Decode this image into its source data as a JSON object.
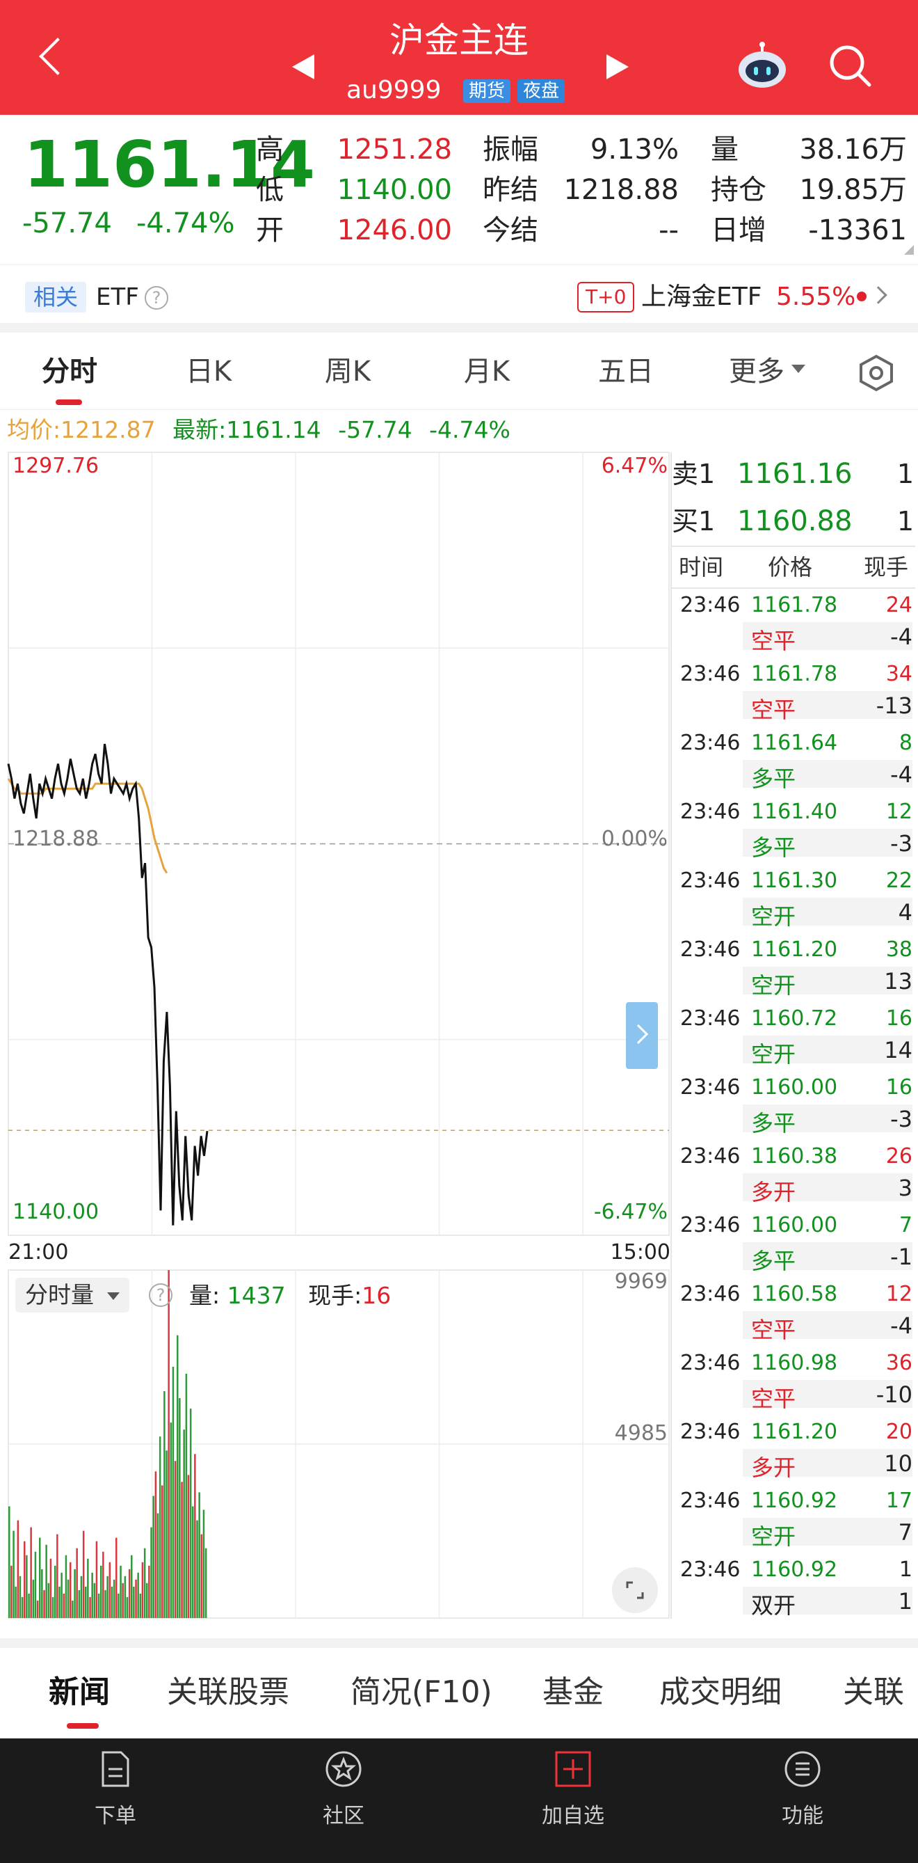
{
  "header": {
    "title": "沪金主连",
    "code": "au9999",
    "tags": [
      "期货",
      "夜盘"
    ]
  },
  "quote": {
    "last": "1161.14",
    "change": "-57.74",
    "change_pct": "-4.74%",
    "fields": [
      {
        "label": "高",
        "value": "1251.28",
        "color": "red"
      },
      {
        "label": "低",
        "value": "1140.00",
        "color": "green"
      },
      {
        "label": "开",
        "value": "1246.00",
        "color": "red"
      },
      {
        "label": "振幅",
        "value": "9.13%",
        "color": "dark"
      },
      {
        "label": "昨结",
        "value": "1218.88",
        "color": "dark"
      },
      {
        "label": "今结",
        "value": "--",
        "color": "dark"
      },
      {
        "label": "量",
        "value": "38.16万",
        "color": "dark"
      },
      {
        "label": "持仓",
        "value": "19.85万",
        "color": "dark"
      },
      {
        "label": "日增",
        "value": "-13361",
        "color": "dark"
      }
    ]
  },
  "etf": {
    "related_label": "相关",
    "etf_label": "ETF",
    "t0_label": "T+0",
    "fund_name": "上海金ETF",
    "fund_pct": "5.55%"
  },
  "tabs": [
    "分时",
    "日K",
    "周K",
    "月K",
    "五日",
    "更多"
  ],
  "active_tab": 0,
  "summary": {
    "avg_label": "均价:",
    "avg_value": "1212.87",
    "latest_label": "最新:",
    "latest_value": "1161.14",
    "change": "-57.74",
    "change_pct": "-4.74%"
  },
  "chart_data": {
    "type": "line",
    "y_top_label": "1297.76",
    "y_mid_label": "1218.88",
    "y_bottom_label": "1140.00",
    "pct_top": "6.47%",
    "pct_mid": "0.00%",
    "pct_bottom": "-6.47%",
    "x_start": "21:00",
    "x_end": "15:00",
    "ylim": [
      1140.0,
      1297.76
    ],
    "series": [
      {
        "values": [
          1235,
          1232,
          1228,
          1231,
          1227,
          1225,
          1229,
          1233,
          1228,
          1224,
          1231,
          1229,
          1232,
          1230,
          1228,
          1232,
          1235,
          1231,
          1229,
          1232,
          1236,
          1233,
          1230,
          1229,
          1232,
          1228,
          1231,
          1235,
          1237,
          1233,
          1231,
          1239,
          1235,
          1229,
          1232,
          1231,
          1230,
          1229,
          1231,
          1228,
          1230,
          1231,
          1224,
          1212,
          1215,
          1200,
          1198,
          1190,
          1170,
          1145,
          1175,
          1185,
          1170,
          1142,
          1165,
          1150,
          1143,
          1160,
          1148,
          1143,
          1158,
          1152,
          1160,
          1156,
          1161
        ]
      },
      {
        "values": [
          1232,
          1231,
          1230,
          1230,
          1229,
          1229,
          1229,
          1229,
          1229,
          1229,
          1229,
          1229,
          1230,
          1230,
          1230,
          1230,
          1230,
          1230,
          1230,
          1230,
          1230,
          1230,
          1230,
          1230,
          1230,
          1230,
          1230,
          1230,
          1231,
          1231,
          1231,
          1231,
          1231,
          1231,
          1231,
          1231,
          1231,
          1231,
          1231,
          1231,
          1231,
          1231,
          1231,
          1230,
          1228,
          1226,
          1223,
          1220,
          1218,
          1216,
          1214,
          1213
        ]
      }
    ],
    "volume": {
      "label": "分时量",
      "top_value": "9969",
      "mid_value": "4985",
      "max": 9969,
      "amount_label": "量:",
      "amount_value": "1437",
      "hand_label": "现手:",
      "hand_value": "16",
      "bars": [
        3200,
        1500,
        2500,
        900,
        2800,
        1200,
        600,
        2200,
        1800,
        700,
        2600,
        1100,
        1900,
        500,
        2300,
        1400,
        800,
        2100,
        1000,
        1700,
        600,
        1500,
        2400,
        900,
        1300,
        700,
        1800,
        1100,
        1600,
        500,
        1400,
        2000,
        800,
        1200,
        2500,
        900,
        1700,
        600,
        1300,
        1000,
        2200,
        700,
        1500,
        1900,
        800,
        1200,
        1600,
        900,
        1100,
        2300,
        700,
        1500,
        1000,
        1200,
        600,
        1400,
        1800,
        900,
        1100,
        1300,
        700,
        1600,
        2000,
        1000,
        1500,
        2600,
        3500,
        4200,
        3000,
        5200,
        3800,
        6500,
        4800,
        9969,
        5600,
        7200,
        4500,
        8100,
        6300,
        3900,
        5400,
        7000,
        4100,
        6000,
        3200,
        4700,
        2800,
        3600,
        2400,
        3100,
        2000
      ]
    }
  },
  "orderbook": {
    "ask_label": "卖1",
    "ask_price": "1161.16",
    "ask_vol": "1",
    "bid_label": "买1",
    "bid_price": "1160.88",
    "bid_vol": "1",
    "col_time": "时间",
    "col_price": "价格",
    "col_hand": "现手",
    "trades": [
      {
        "time": "23:46",
        "price": "1161.78",
        "vol": "24",
        "type": "空平",
        "chg": "-4",
        "vol_color": "red",
        "type_color": "red"
      },
      {
        "time": "23:46",
        "price": "1161.78",
        "vol": "34",
        "type": "空平",
        "chg": "-13",
        "vol_color": "red",
        "type_color": "red"
      },
      {
        "time": "23:46",
        "price": "1161.64",
        "vol": "8",
        "type": "多平",
        "chg": "-4",
        "vol_color": "green",
        "type_color": "green"
      },
      {
        "time": "23:46",
        "price": "1161.40",
        "vol": "12",
        "type": "多平",
        "chg": "-3",
        "vol_color": "green",
        "type_color": "green"
      },
      {
        "time": "23:46",
        "price": "1161.30",
        "vol": "22",
        "type": "空开",
        "chg": "4",
        "vol_color": "green",
        "type_color": "green"
      },
      {
        "time": "23:46",
        "price": "1161.20",
        "vol": "38",
        "type": "空开",
        "chg": "13",
        "vol_color": "green",
        "type_color": "green"
      },
      {
        "time": "23:46",
        "price": "1160.72",
        "vol": "16",
        "type": "空开",
        "chg": "14",
        "vol_color": "green",
        "type_color": "green"
      },
      {
        "time": "23:46",
        "price": "1160.00",
        "vol": "16",
        "type": "多平",
        "chg": "-3",
        "vol_color": "green",
        "type_color": "green"
      },
      {
        "time": "23:46",
        "price": "1160.38",
        "vol": "26",
        "type": "多开",
        "chg": "3",
        "vol_color": "red",
        "type_color": "red"
      },
      {
        "time": "23:46",
        "price": "1160.00",
        "vol": "7",
        "type": "多平",
        "chg": "-1",
        "vol_color": "green",
        "type_color": "green"
      },
      {
        "time": "23:46",
        "price": "1160.58",
        "vol": "12",
        "type": "空平",
        "chg": "-4",
        "vol_color": "red",
        "type_color": "red"
      },
      {
        "time": "23:46",
        "price": "1160.98",
        "vol": "36",
        "type": "空平",
        "chg": "-10",
        "vol_color": "red",
        "type_color": "red"
      },
      {
        "time": "23:46",
        "price": "1161.20",
        "vol": "20",
        "type": "多开",
        "chg": "10",
        "vol_color": "red",
        "type_color": "red"
      },
      {
        "time": "23:46",
        "price": "1160.92",
        "vol": "17",
        "type": "空开",
        "chg": "7",
        "vol_color": "green",
        "type_color": "green"
      },
      {
        "time": "23:46",
        "price": "1160.92",
        "vol": "1",
        "type": "双开",
        "chg": "1",
        "vol_color": "dark",
        "type_color": "dark"
      }
    ]
  },
  "news_tabs": [
    "新闻",
    "关联股票",
    "简况(F10)",
    "基金",
    "成交明细",
    "关联"
  ],
  "bottom_nav": [
    "下单",
    "社区",
    "加自选",
    "功能"
  ],
  "colors": {
    "brand_red": "#ee333a",
    "up": "#e0232b",
    "down": "#11911e",
    "avg_line": "#e8a23a"
  }
}
